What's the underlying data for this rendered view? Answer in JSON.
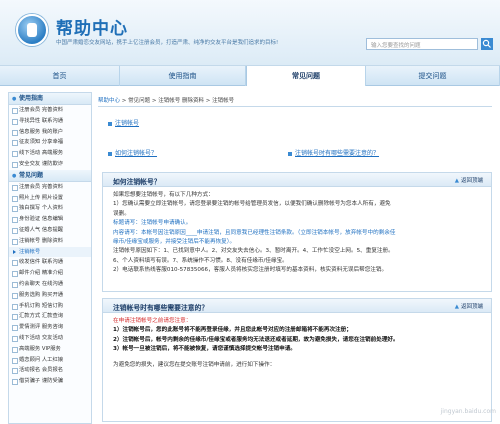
{
  "header": {
    "title": "帮助中心",
    "subtitle": "中国严肃婚恋交友网站，携手上亿注册会员，打造严肃、纯净的交友平台是我们追求的目标!",
    "search_placeholder": "输入您要查找的问题"
  },
  "nav": {
    "items": [
      "首页",
      "使用指南",
      "常见问题",
      "提交问题"
    ],
    "active_index": 2
  },
  "sidebar": {
    "section1_title": "使用指南",
    "section1_items": [
      "注册会员 完善资料",
      "寻找异性 联系沟通",
      "信息服务 我的账户",
      "征友须知 分享幸福",
      "线下活动 高端服务",
      "安全交友 谨防欺诈"
    ],
    "section2_title": "常见问题",
    "section2_items": [
      "注册会员 完善资料",
      "照片上传 照片设置",
      "独白撰写 个人资料",
      "身份验证 信息编辑",
      "征婚人气 信息提醒",
      "注销帐号 删除资料",
      "注销帐号",
      "收发信件 联系沟通",
      "邮件介绍 精准介绍",
      "约会聊天 在线沟通",
      "服务选购 购买开通",
      "手机订购 短信订购",
      "汇款方式 汇款查询",
      "爱情测评 服务咨询",
      "线下活动 交友活动",
      "高端服务 VIP服务",
      "婚恋顾问 人工红娘",
      "活动报名 会员报名",
      "借贷骗子 谨防受骗"
    ],
    "active_item": "注销帐号"
  },
  "breadcrumb": {
    "home": "帮助中心",
    "rest": " > 常见问题 > 注销帐号 删除资料 > 注销帐号"
  },
  "main": {
    "top_link": "注销帐号",
    "q1": "如何注销帐号？",
    "q2": "注销帐号时有哪些需要注意的？",
    "back_top": "返回顶端",
    "box1": {
      "title": "如何注销帐号？",
      "lines": [
        "如果您想要注销帐号，有以下几种方式：",
        "1）您确认需要立即注销帐号，请您登录要注销的帐号给管理员发信，以便我们确认删除帐号为您本人所有，避免",
        "误删。",
        "标题请写：注销帐号申请确认。",
        "内容请写：本帐号因注销原因____申请注销，且同意我已经理性注销条款。（立即注销本帐号，放弃帐号中的剩余佳",
        "缘币/佳缘宝或服务，并接受注销后不能再恢复）。",
        "注销帐号原因如下：1、已找到意中人。2、对交友失去信心。3、暂时离开。4、工作忙没空上网。5、重复注册。",
        "6、个人资料填写有误。7、系统操作不习惯。8、没有佳缘币/佳缘宝。",
        "2）电话联系热线客服010-57835066，客服人员将核实您注册时填写的基本资料，核实资料无误后帮您注销。"
      ]
    },
    "box2": {
      "title": "注销帐号时有哪些需要注意的？",
      "warn": "在申请注销帐号之前请您注意：",
      "lines": [
        "1）注销帐号后，您的此账号将不能再登录佳缘，并且您此帐号对应的注册邮箱将不能再次注册；",
        "2）注销帐号后，帐号内剩余的佳缘币/佳缘宝或者服务均无法退还或者延期，故为避免损失，请您在注销前处理好。",
        "3）帐号一旦被注销后，将不能被恢复，请您谨慎选择提交帐号注销申请。"
      ],
      "footer": "为避免您的损失，建议您在提交账号注销申请前，进行如下操作："
    }
  },
  "watermark": "jingyan.baidu.com",
  "colors": {
    "accent": "#1e6fc0",
    "warn": "#d42a2a",
    "nav_bg": "#cfe4f4"
  }
}
